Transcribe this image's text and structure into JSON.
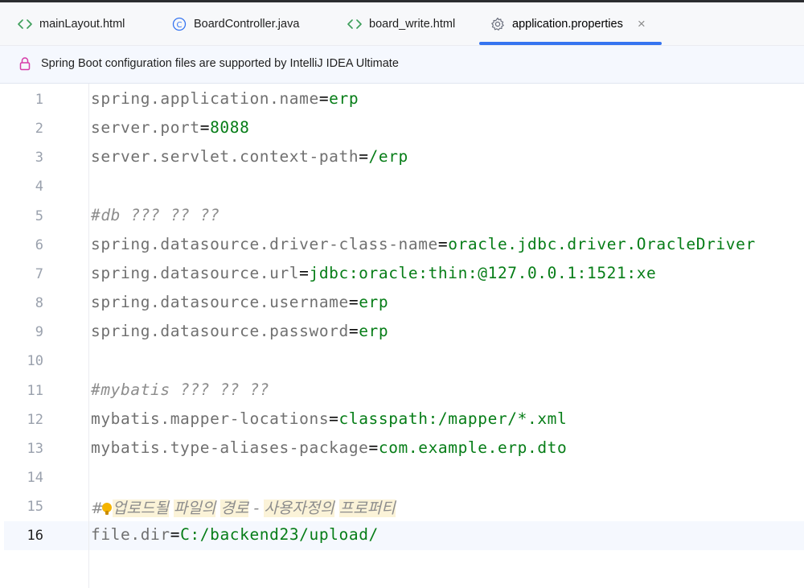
{
  "tabs": [
    {
      "label": "mainLayout.html",
      "icon": "html-file-icon",
      "active": false
    },
    {
      "label": "BoardController.java",
      "icon": "java-class-icon",
      "active": false
    },
    {
      "label": "board_write.html",
      "icon": "html-file-icon",
      "active": false
    },
    {
      "label": "application.properties",
      "icon": "gear-icon",
      "active": true
    }
  ],
  "banner": {
    "icon": "lock-icon",
    "text": "Spring Boot configuration files are supported by IntelliJ IDEA Ultimate"
  },
  "editor": {
    "current_line": 16,
    "lines": [
      {
        "n": "1",
        "key": "spring.application.name",
        "eq": "=",
        "val": "erp"
      },
      {
        "n": "2",
        "key": "server.port",
        "eq": "=",
        "val": "8088"
      },
      {
        "n": "3",
        "key": "server.servlet.context-path",
        "eq": "=",
        "val": "/erp"
      },
      {
        "n": "4"
      },
      {
        "n": "5",
        "comment": "#db ??? ?? ??"
      },
      {
        "n": "6",
        "key": "spring.datasource.driver-class-name",
        "eq": "=",
        "val": "oracle.jdbc.driver.OracleDriver"
      },
      {
        "n": "7",
        "key": "spring.datasource.url",
        "eq": "=",
        "val": "jdbc:oracle:thin:@127.0.0.1:1521:xe"
      },
      {
        "n": "8",
        "key": "spring.datasource.username",
        "eq": "=",
        "val": "erp"
      },
      {
        "n": "9",
        "key": "spring.datasource.password",
        "eq": "=",
        "val": "erp"
      },
      {
        "n": "10"
      },
      {
        "n": "11",
        "comment": "#mybatis ??? ?? ??"
      },
      {
        "n": "12",
        "key": "mybatis.mapper-locations",
        "eq": "=",
        "val": "classpath:/mapper/*.xml"
      },
      {
        "n": "13",
        "key": "mybatis.type-aliases-package",
        "eq": "=",
        "val": "com.example.erp.dto"
      },
      {
        "n": "14"
      },
      {
        "n": "15",
        "comment_prefix": "#",
        "comment_words": [
          "업로드될",
          "파일의",
          "경로",
          "-",
          "사용자정의",
          "프로퍼티"
        ]
      },
      {
        "n": "16",
        "key": "file.dir",
        "eq": "=",
        "val": "C:/backend23/upload/"
      }
    ]
  },
  "colors": {
    "accent": "#3574f0",
    "key": "#707070",
    "value": "#067d17",
    "comment": "#8c8c8c",
    "highlight": "#fbf3d8"
  }
}
